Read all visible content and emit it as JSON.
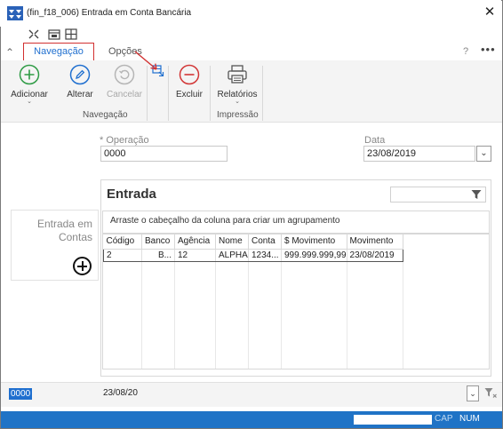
{
  "window": {
    "title": "(fin_f18_006) Entrada em Conta Bancária",
    "close": "✕"
  },
  "tabs": {
    "navegacao": "Navegação",
    "opcoes": "Opções",
    "help": "?",
    "more": "•••"
  },
  "ribbon": {
    "adicionar": "Adicionar",
    "alterar": "Alterar",
    "cancelar": "Cancelar",
    "excluir": "Excluir",
    "relatorios": "Relatórios",
    "group_navegacao": "Navegação",
    "group_impressao": "Impressão"
  },
  "form": {
    "operacao_label": "* Operação",
    "operacao_value": "0000",
    "data_label": "Data",
    "data_value": "23/08/2019"
  },
  "card": {
    "line1": "Entrada em",
    "line2": "Contas"
  },
  "grid": {
    "title": "Entrada",
    "group_hint": "Arraste o cabeçalho da coluna para criar um agrupamento",
    "columns": [
      "Código",
      "Banco",
      "Agência",
      "Nome",
      "Conta",
      "$ Movimento",
      "Movimento"
    ],
    "rows": [
      [
        "2",
        "B...",
        "12",
        "ALPHA",
        "1234...",
        "999.999.999,99",
        "23/08/2019"
      ]
    ]
  },
  "findbar": {
    "code": "0000",
    "date": "23/08/20"
  },
  "status": {
    "cap": "CAP",
    "num": "NUM"
  },
  "colors": {
    "accent": "#1f6fcf",
    "status_bar": "#1f73c6",
    "highlight_box": "#d23030",
    "annotation_arrow": "#d23030"
  }
}
